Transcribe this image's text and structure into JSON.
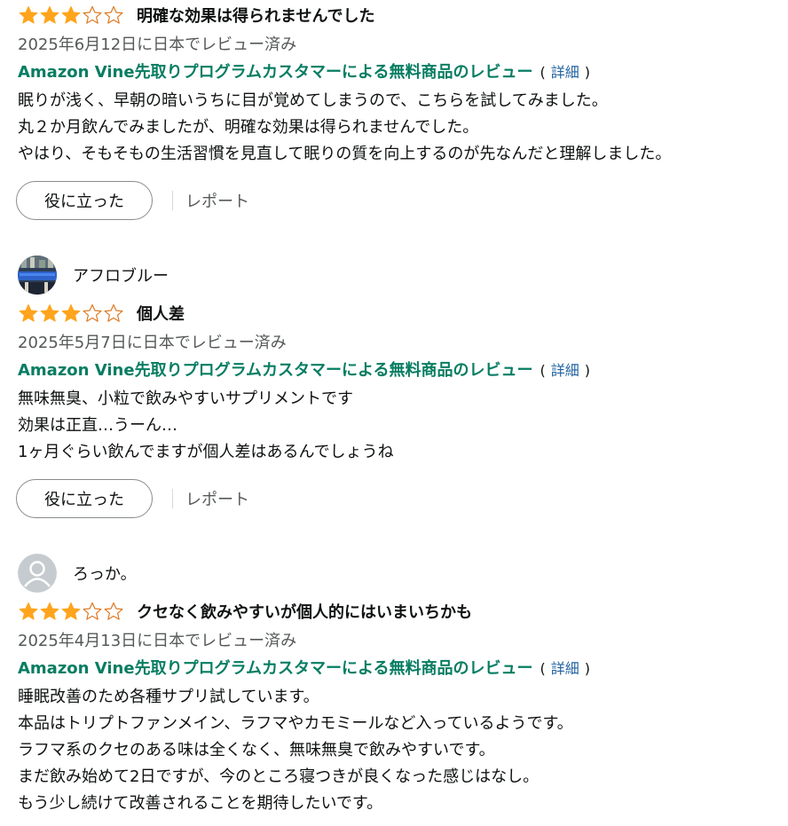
{
  "colors": {
    "star_filled": "#ffa41c",
    "star_outline": "#de7921",
    "vine_link": "#067d62",
    "detail_link": "#2162a1",
    "meta_text": "#565959"
  },
  "icons": {
    "star_full": "star-filled-icon",
    "star_empty": "star-outline-icon",
    "avatar_default": "default-user-avatar-icon",
    "avatar_photo": "user-photo-avatar"
  },
  "reviews": [
    {
      "rating": 3,
      "title": "明確な効果は得られませんでした",
      "date": "2025年6月12日に日本でレビュー済み",
      "vine_label": "Amazon Vine先取りプログラムカスタマーによる無料商品のレビュー",
      "detail_open": "(",
      "detail_label": "詳細",
      "detail_close": ")",
      "body": [
        "眠りが浅く、早朝の暗いうちに目が覚めてしまうので、こちらを試してみました。",
        "丸２か月飲んでみましたが、明確な効果は得られませんでした。",
        "やはり、そもそもの生活習慣を見直して眠りの質を向上するのが先なんだと理解しました。"
      ],
      "helpful_label": "役に立った",
      "report_label": "レポート"
    },
    {
      "reviewer": "アフロブルー",
      "rating": 3,
      "title": "個人差",
      "date": "2025年5月7日に日本でレビュー済み",
      "vine_label": "Amazon Vine先取りプログラムカスタマーによる無料商品のレビュー",
      "detail_open": "(",
      "detail_label": "詳細",
      "detail_close": ")",
      "body": [
        "無味無臭、小粒で飲みやすいサプリメントです",
        "効果は正直…うーん…",
        "1ヶ月ぐらい飲んでますが個人差はあるんでしょうね"
      ],
      "helpful_label": "役に立った",
      "report_label": "レポート"
    },
    {
      "reviewer": "ろっか。",
      "rating": 3,
      "title": "クセなく飲みやすいが個人的にはいまいちかも",
      "date": "2025年4月13日に日本でレビュー済み",
      "vine_label": "Amazon Vine先取りプログラムカスタマーによる無料商品のレビュー",
      "detail_open": "(",
      "detail_label": "詳細",
      "detail_close": ")",
      "body": [
        "睡眠改善のため各種サプリ試しています。",
        "本品はトリプトファンメイン、ラフマやカモミールなど入っているようです。",
        "ラフマ系のクセのある味は全くなく、無味無臭で飲みやすいです。",
        "まだ飲み始めて2日ですが、今のところ寝つきが良くなった感じはなし。",
        "もう少し続けて改善されることを期待したいです。"
      ]
    }
  ]
}
